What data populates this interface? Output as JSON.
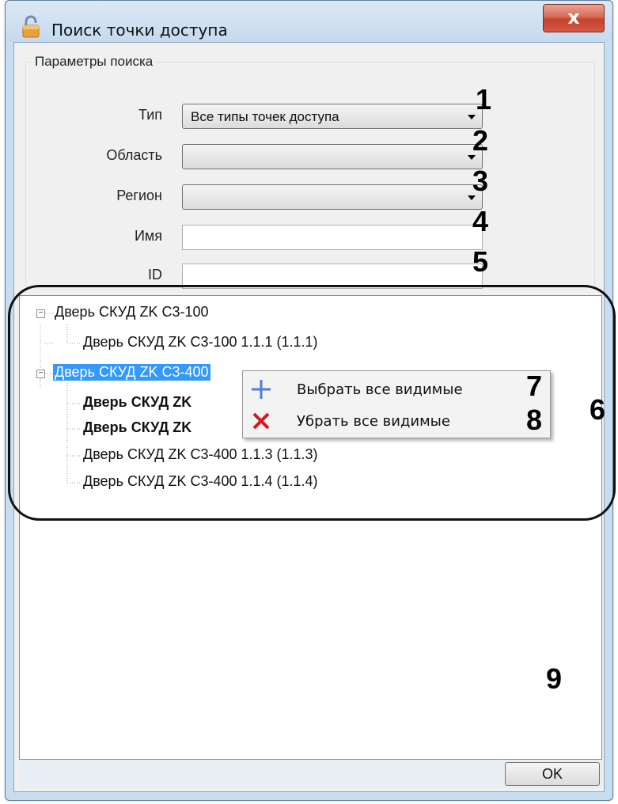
{
  "window": {
    "title": "Поиск точки доступа",
    "close_label": "x",
    "lock_icon": "lock-icon"
  },
  "search_params": {
    "legend": "Параметры поиска",
    "type_label": "Тип",
    "type_value": "Все типы точек доступа",
    "area_label": "Область",
    "area_value": "",
    "region_label": "Регион",
    "region_value": "",
    "name_label": "Имя",
    "name_value": "",
    "id_label": "ID",
    "id_value": ""
  },
  "tree": {
    "items": [
      {
        "label": "Дверь СКУД ZK C3-100",
        "level": 0,
        "bold": false,
        "selected": false
      },
      {
        "label": "Дверь СКУД ZK C3-100 1.1.1 (1.1.1)",
        "level": 1,
        "bold": false,
        "selected": false
      },
      {
        "label": "Дверь СКУД ZK C3-400",
        "level": 0,
        "bold": false,
        "selected": true
      },
      {
        "label": "Дверь СКУД ZK",
        "level": 1,
        "bold": true,
        "selected": false
      },
      {
        "label": "Дверь СКУД ZK",
        "level": 1,
        "bold": true,
        "selected": false
      },
      {
        "label": "Дверь СКУД ZK C3-400 1.1.3 (1.1.3)",
        "level": 1,
        "bold": false,
        "selected": false
      },
      {
        "label": "Дверь СКУД ZK C3-400 1.1.4 (1.1.4)",
        "level": 1,
        "bold": false,
        "selected": false
      }
    ]
  },
  "context_menu": {
    "select_all_visible": "Выбрать все видимые",
    "remove_all_visible": "Убрать все видимые",
    "select_icon": "plus-icon",
    "remove_icon": "close-icon",
    "select_icon_color": "#4f7fd8",
    "remove_icon_color": "#d8161b"
  },
  "footer": {
    "ok_label": "OK"
  },
  "callouts": {
    "c1": "1",
    "c2": "2",
    "c3": "3",
    "c4": "4",
    "c5": "5",
    "c6": "6",
    "c7": "7",
    "c8": "8",
    "c9": "9"
  },
  "colors": {
    "selection": "#3399ff",
    "window_frame": "#c9ddf0",
    "close_button": "#c5402a"
  }
}
